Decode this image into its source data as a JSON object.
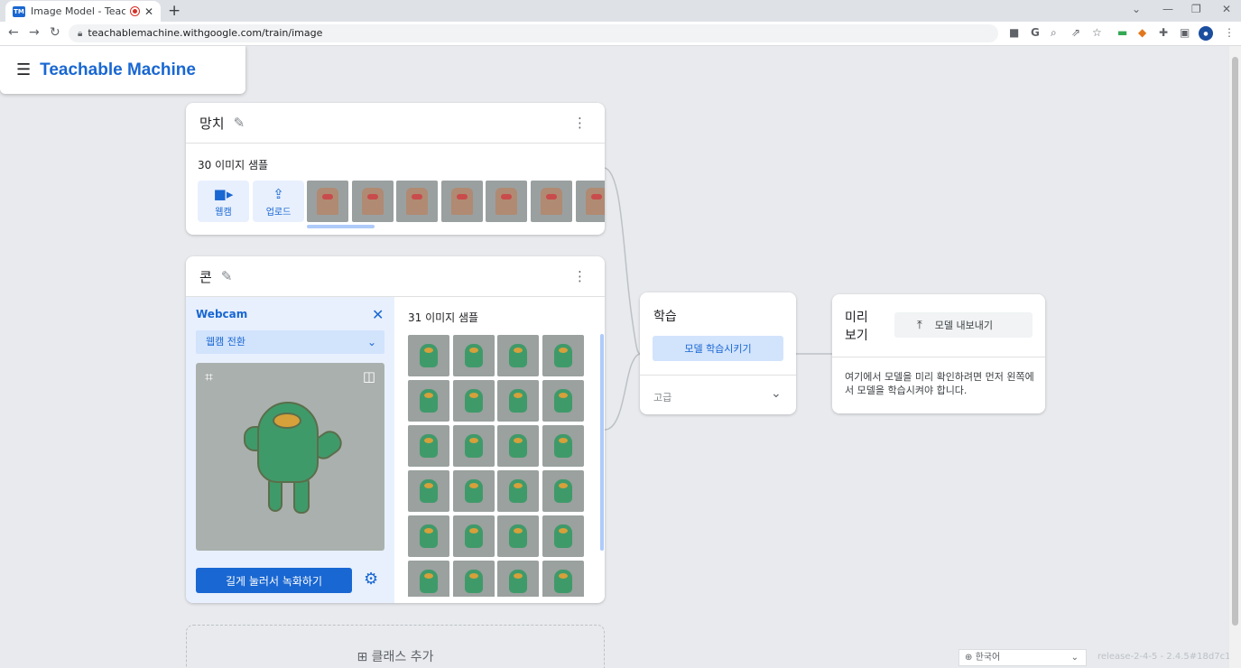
{
  "browser": {
    "tab_title": "Image Model - Teachable M",
    "favicon": "TM",
    "url": "teachablemachine.withgoogle.com/train/image"
  },
  "header": {
    "brand": "Teachable Machine"
  },
  "class1": {
    "name": "망치",
    "samples_label": "30 이미지 샘플",
    "webcam_label": "웹캠",
    "upload_label": "업로드"
  },
  "class2": {
    "name": "콘",
    "webcam_title": "Webcam",
    "webcam_select": "웹캠 전환",
    "hold_button": "길게 눌러서 녹화하기",
    "samples_label": "31 이미지 샘플"
  },
  "add_class": {
    "label": "클래스 추가"
  },
  "training": {
    "title": "학습",
    "train_button": "모델 학습시키기",
    "advanced": "고급"
  },
  "preview": {
    "title": "미리 보기",
    "export_button": "모델 내보내기",
    "message": "여기에서 모델을 미리 확인하려면 먼저 왼쪽에서 모델을 학습시켜야 합니다."
  },
  "footer": {
    "language": "한국어",
    "release": "release-2-4-5 - 2.4.5#18d7c1"
  },
  "colors": {
    "accent": "#1967d2",
    "light_accent": "#e8f0fe"
  }
}
